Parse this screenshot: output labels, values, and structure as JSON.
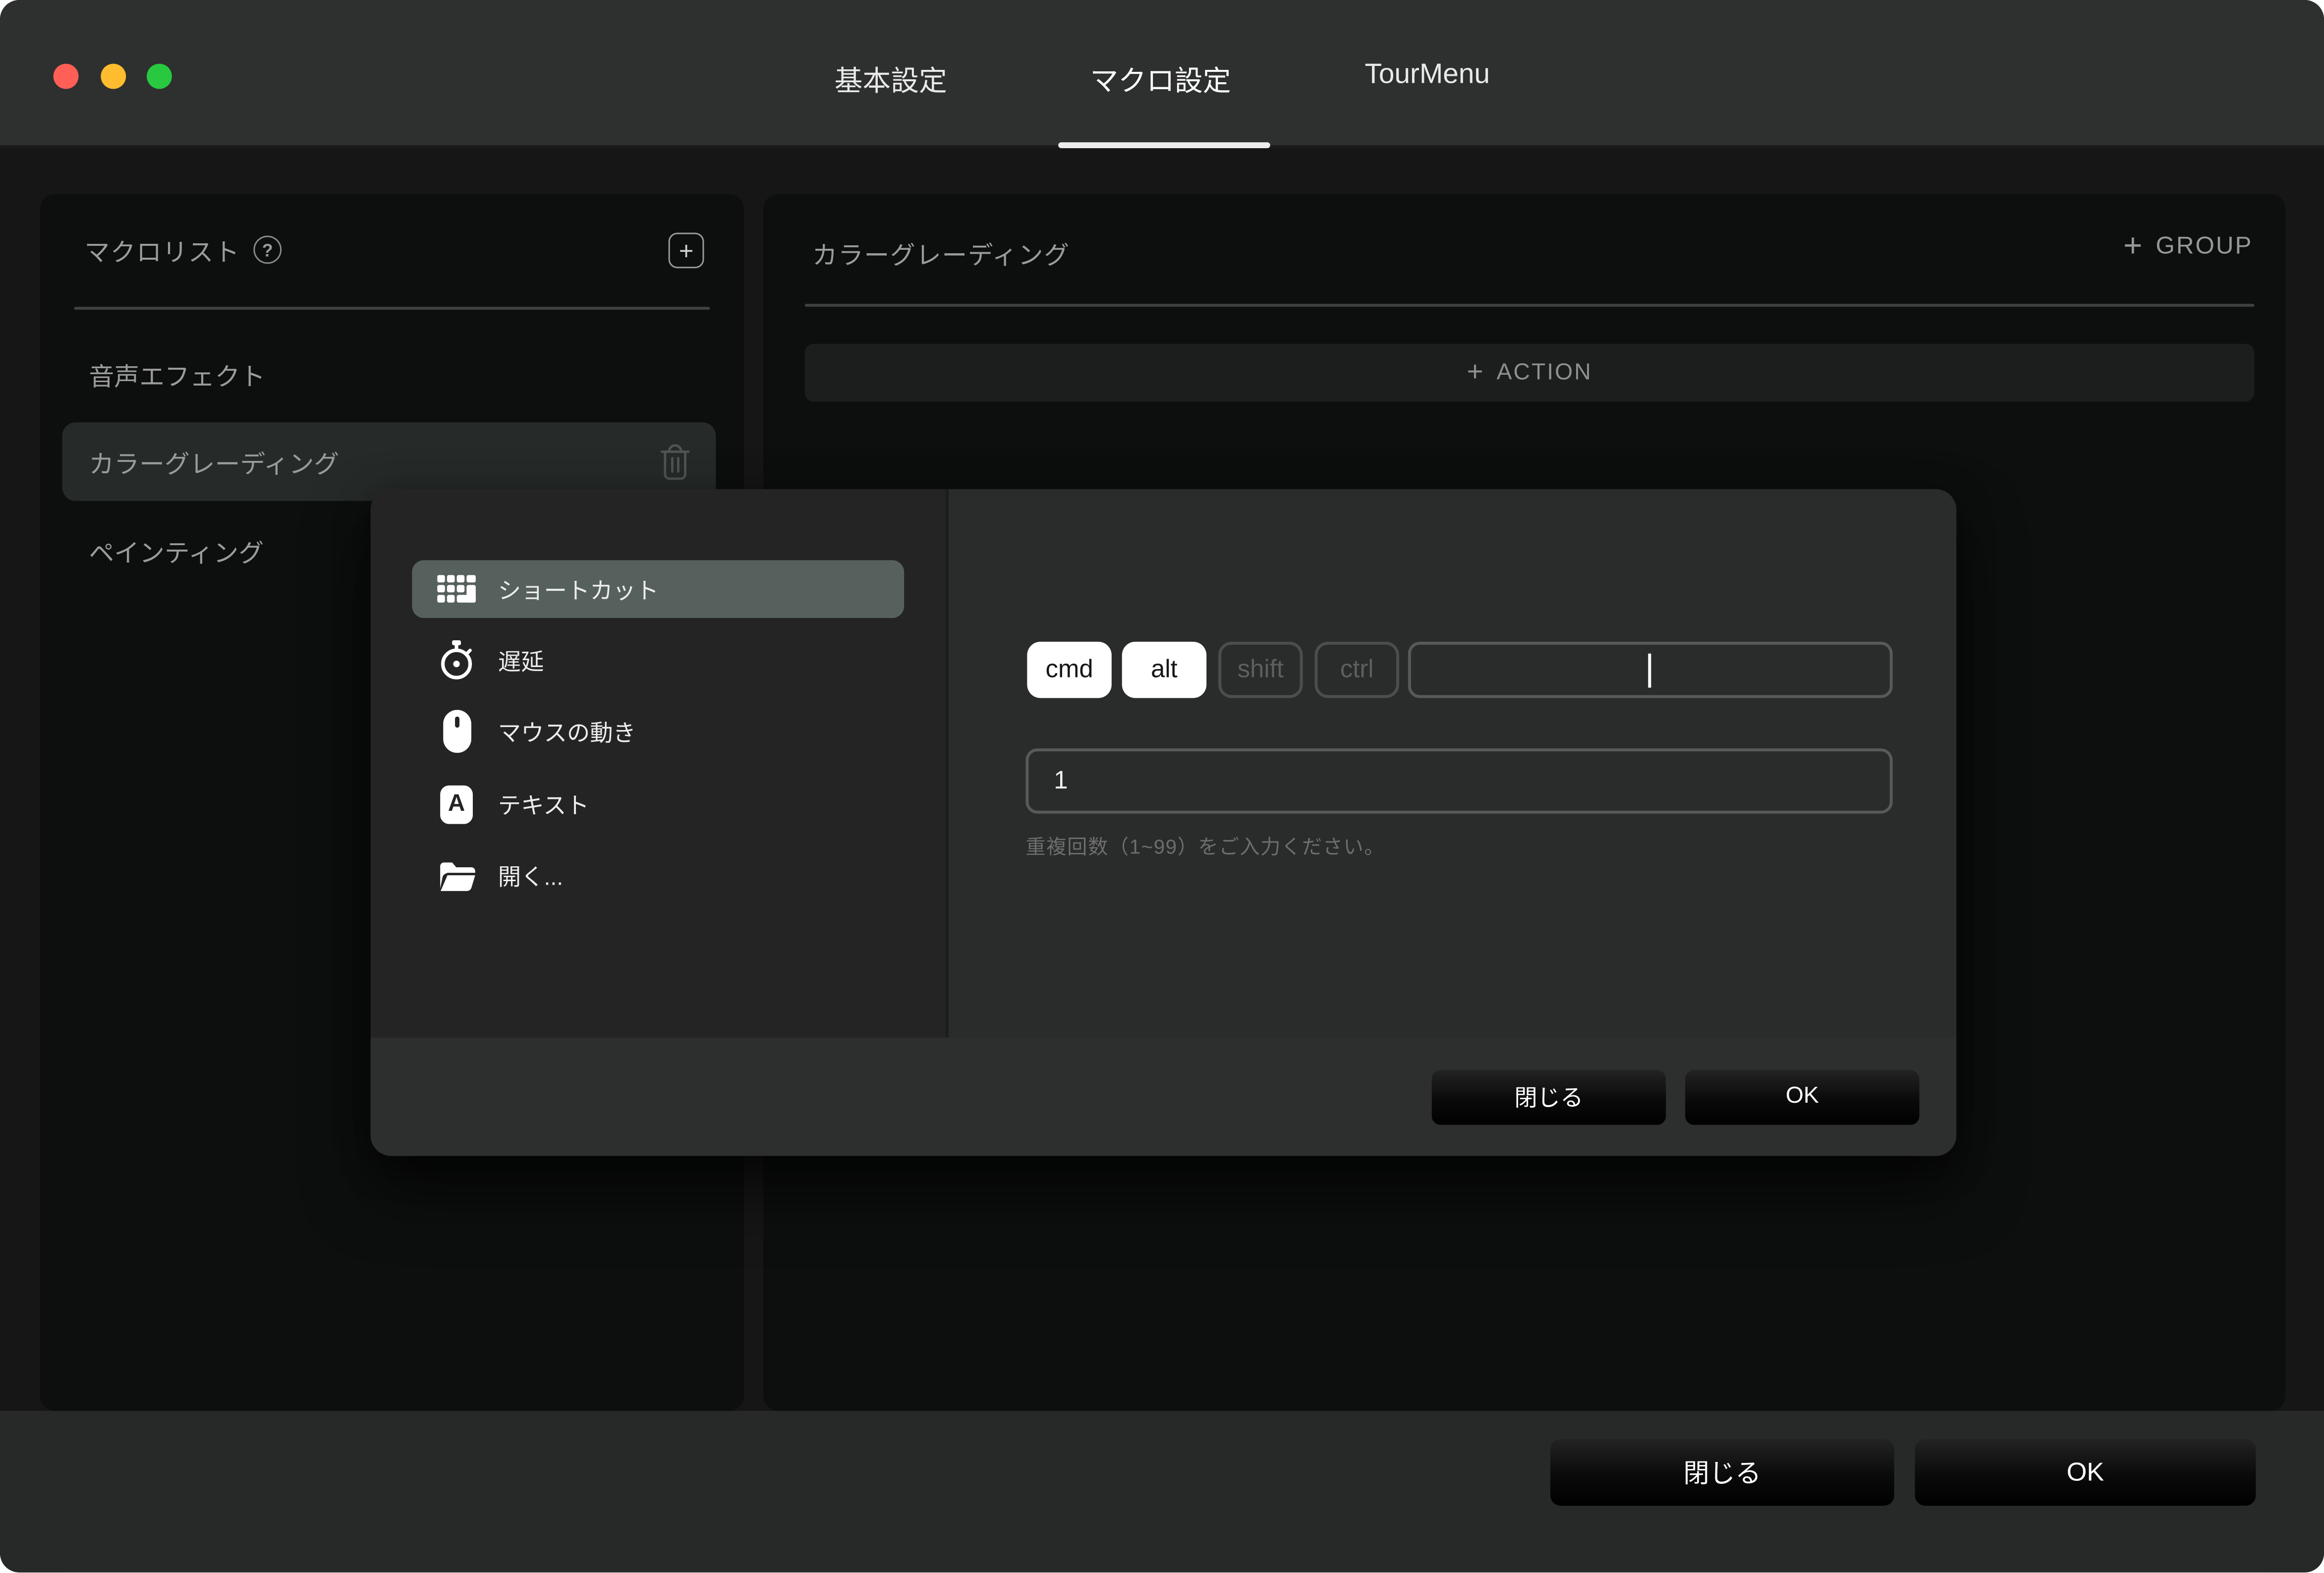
{
  "colors": {
    "titlebar_bg": "#2e2f2f",
    "window_bg": "#161617",
    "panel_bg": "#0d0e0e",
    "bottombar_bg": "#272828",
    "dialog_menu_bg": "#242425",
    "dialog_content_bg": "#2a2b2b",
    "dialog_footer_bg": "#2d2e2e",
    "menu_selected_bg": "#56615e",
    "sidebar_selected_bg": "#262b2a",
    "traffic_red": "#ff5f57",
    "traffic_yellow": "#febc2e",
    "traffic_green": "#28c840",
    "muted_text": "#9b9b9b",
    "active_underline": "#ececec"
  },
  "icons": {
    "plus": "+",
    "question": "?",
    "text_letter": "A"
  },
  "titlebar": {
    "tabs": [
      {
        "label": "基本設定",
        "active": false
      },
      {
        "label": "マクロ設定",
        "active": true
      },
      {
        "label": "TourMenu",
        "active": false
      }
    ]
  },
  "sidebar": {
    "title": "マクロリスト",
    "items": [
      {
        "label": "音声エフェクト",
        "selected": false
      },
      {
        "label": "カラーグレーディング",
        "selected": true
      },
      {
        "label": "ペインティング",
        "selected": false
      }
    ]
  },
  "macro_panel": {
    "title": "カラーグレーディング",
    "group_button_label": "GROUP",
    "action_button_label": "ACTION"
  },
  "dialog": {
    "menu": [
      {
        "label": "ショートカット",
        "icon": "keyboard-icon",
        "selected": true
      },
      {
        "label": "遅延",
        "icon": "stopwatch-icon",
        "selected": false
      },
      {
        "label": "マウスの動き",
        "icon": "mouse-icon",
        "selected": false
      },
      {
        "label": "テキスト",
        "icon": "text-icon",
        "selected": false
      },
      {
        "label": "開く...",
        "icon": "folder-open-icon",
        "selected": false
      }
    ],
    "shortcut": {
      "modifiers": [
        {
          "label": "cmd",
          "active": true
        },
        {
          "label": "alt",
          "active": true
        },
        {
          "label": "shift",
          "active": false
        },
        {
          "label": "ctrl",
          "active": false
        }
      ],
      "key_value": "",
      "repeat_value": "1",
      "hint": "重複回数（1~99）をご入力ください。"
    },
    "footer": {
      "close_label": "閉じる",
      "ok_label": "OK"
    }
  },
  "footer": {
    "close_label": "閉じる",
    "ok_label": "OK"
  }
}
